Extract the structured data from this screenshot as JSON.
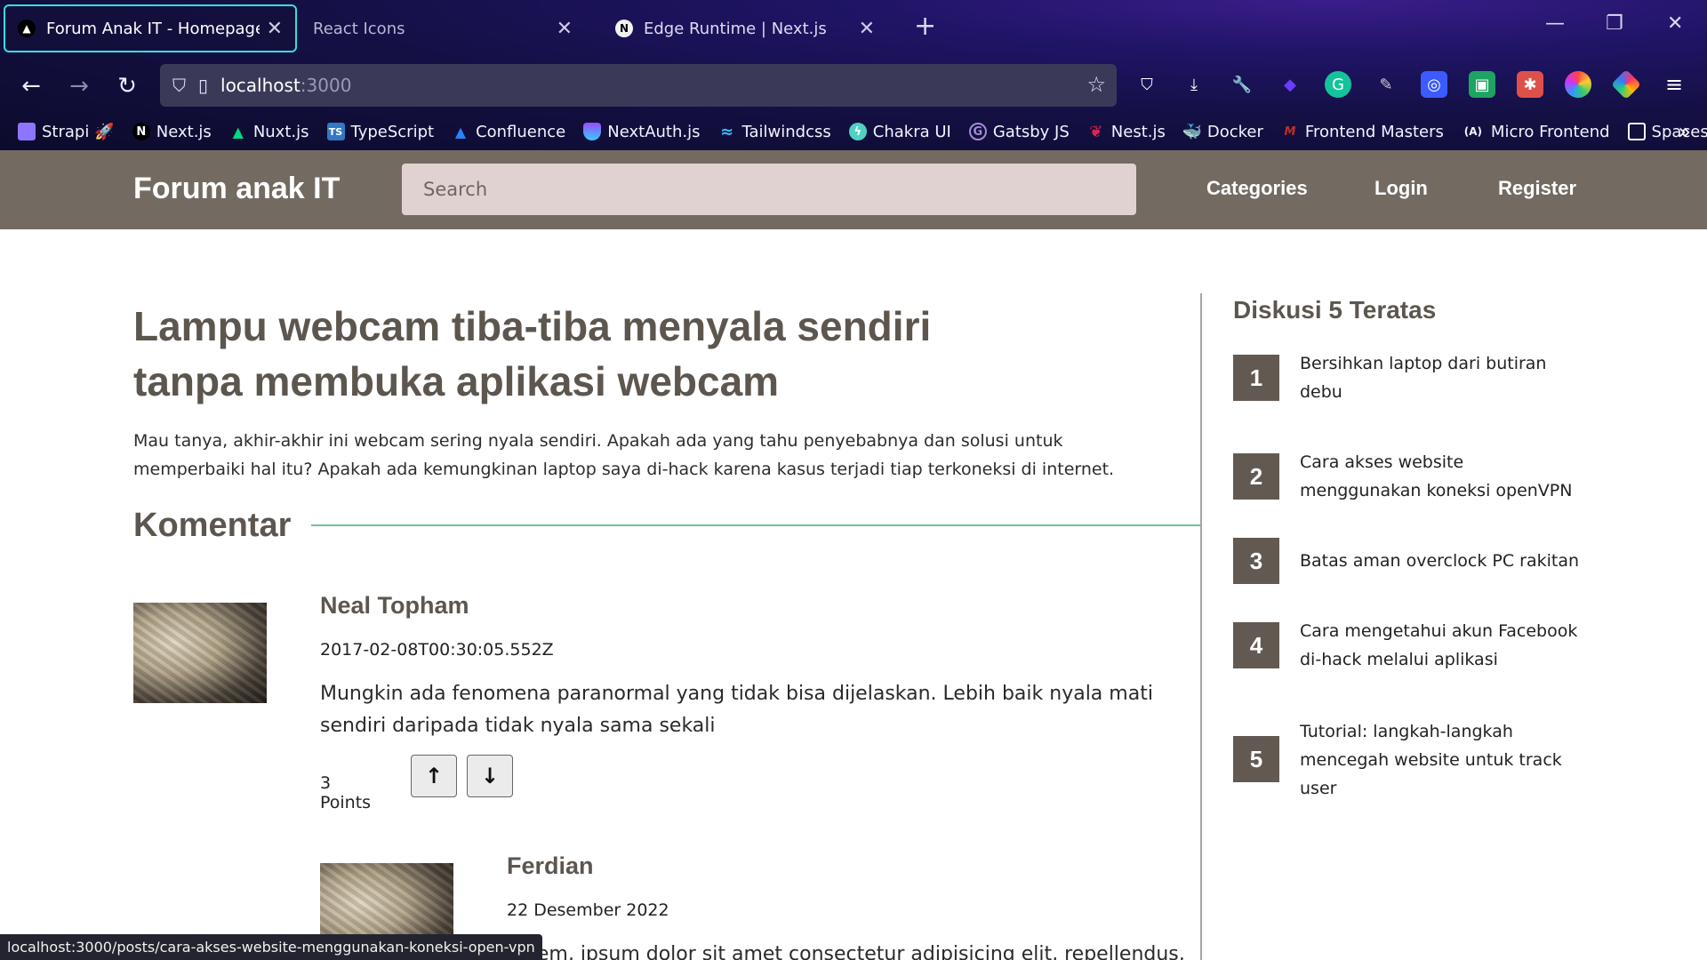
{
  "browser": {
    "tabs": [
      {
        "title": "Forum Anak IT - Homepage",
        "icon": "triangle-icon"
      },
      {
        "title": "React Icons",
        "icon": ""
      },
      {
        "title": "Edge Runtime | Next.js",
        "icon": "nextjs-icon"
      }
    ],
    "new_tab": "+",
    "url_host": "localhost",
    "url_port": ":3000",
    "bookmarks": [
      {
        "label": "Strapi",
        "icon": "strapi-icon",
        "color": "#8e75ff"
      },
      {
        "label": "Next.js",
        "icon": "nextjs-icon",
        "color": "#000000"
      },
      {
        "label": "Nuxt.js",
        "icon": "nuxt-icon",
        "color": "#00dc82"
      },
      {
        "label": "TypeScript",
        "icon": "typescript-icon",
        "color": "#3178c6"
      },
      {
        "label": "Confluence",
        "icon": "confluence-icon",
        "color": "#2684ff"
      },
      {
        "label": "NextAuth.js",
        "icon": "nextauth-icon",
        "color": "#9c4bff"
      },
      {
        "label": "Tailwindcss",
        "icon": "tailwind-icon",
        "color": "#38bdf8"
      },
      {
        "label": "Chakra UI",
        "icon": "chakra-icon",
        "color": "#4fd1c5"
      },
      {
        "label": "Gatsby JS",
        "icon": "gatsby-icon",
        "color": "#663399"
      },
      {
        "label": "Nest.js",
        "icon": "nestjs-icon",
        "color": "#e0234e"
      },
      {
        "label": "Docker",
        "icon": "docker-icon",
        "color": "#2496ed"
      },
      {
        "label": "Frontend Masters",
        "icon": "frontend-masters-icon",
        "color": "#c02d28"
      },
      {
        "label": "Micro Frontend",
        "icon": "micro-frontend-icon",
        "color": "#ffffff"
      },
      {
        "label": "Spaces",
        "icon": "folder-icon",
        "color": "#ffffff"
      }
    ],
    "status_url": "localhost:3000/posts/cara-akses-website-menggunakan-koneksi-open-vpn"
  },
  "site": {
    "brand": "Forum anak IT",
    "search_placeholder": "Search",
    "nav": {
      "categories": "Categories",
      "login": "Login",
      "register": "Register"
    }
  },
  "post": {
    "title": "Lampu webcam tiba-tiba menyala sendiri tanpa membuka aplikasi webcam",
    "body": "Mau tanya, akhir-akhir ini webcam sering nyala sendiri. Apakah ada yang tahu penyebabnya dan solusi untuk memperbaiki hal itu? Apakah ada kemungkinan laptop saya di-hack karena kasus terjadi tiap terkoneksi di internet."
  },
  "comments_heading": "Komentar",
  "comments": [
    {
      "author": "Neal Topham",
      "date": "2017-02-08T00:30:05.552Z",
      "text": "Mungkin ada fenomena paranormal yang tidak bisa dijelaskan. Lebih baik nyala mati sendiri daripada tidak nyala sama sekali",
      "points": "3 Points"
    },
    {
      "author": "Ferdian",
      "date": "22 Desember 2022",
      "text": "Lorem, ipsum dolor sit amet consectetur adipisicing elit, repellendus,"
    }
  ],
  "sidebar": {
    "title": "Diskusi 5 Teratas",
    "items": [
      {
        "rank": "1",
        "title": "Bersihkan laptop dari butiran debu"
      },
      {
        "rank": "2",
        "title": "Cara akses website menggunakan koneksi openVPN"
      },
      {
        "rank": "3",
        "title": "Batas aman overclock PC rakitan"
      },
      {
        "rank": "4",
        "title": "Cara mengetahui akun Facebook di-hack melalui aplikasi"
      },
      {
        "rank": "5",
        "title": "Tutorial: langkah-langkah mencegah website untuk track user"
      }
    ]
  },
  "colors": {
    "header_bg": "#736b62",
    "heading": "#5d564f",
    "rank_bg": "#625a52",
    "search_bg": "#e1d2d2",
    "accent_line": "#6fc493"
  }
}
